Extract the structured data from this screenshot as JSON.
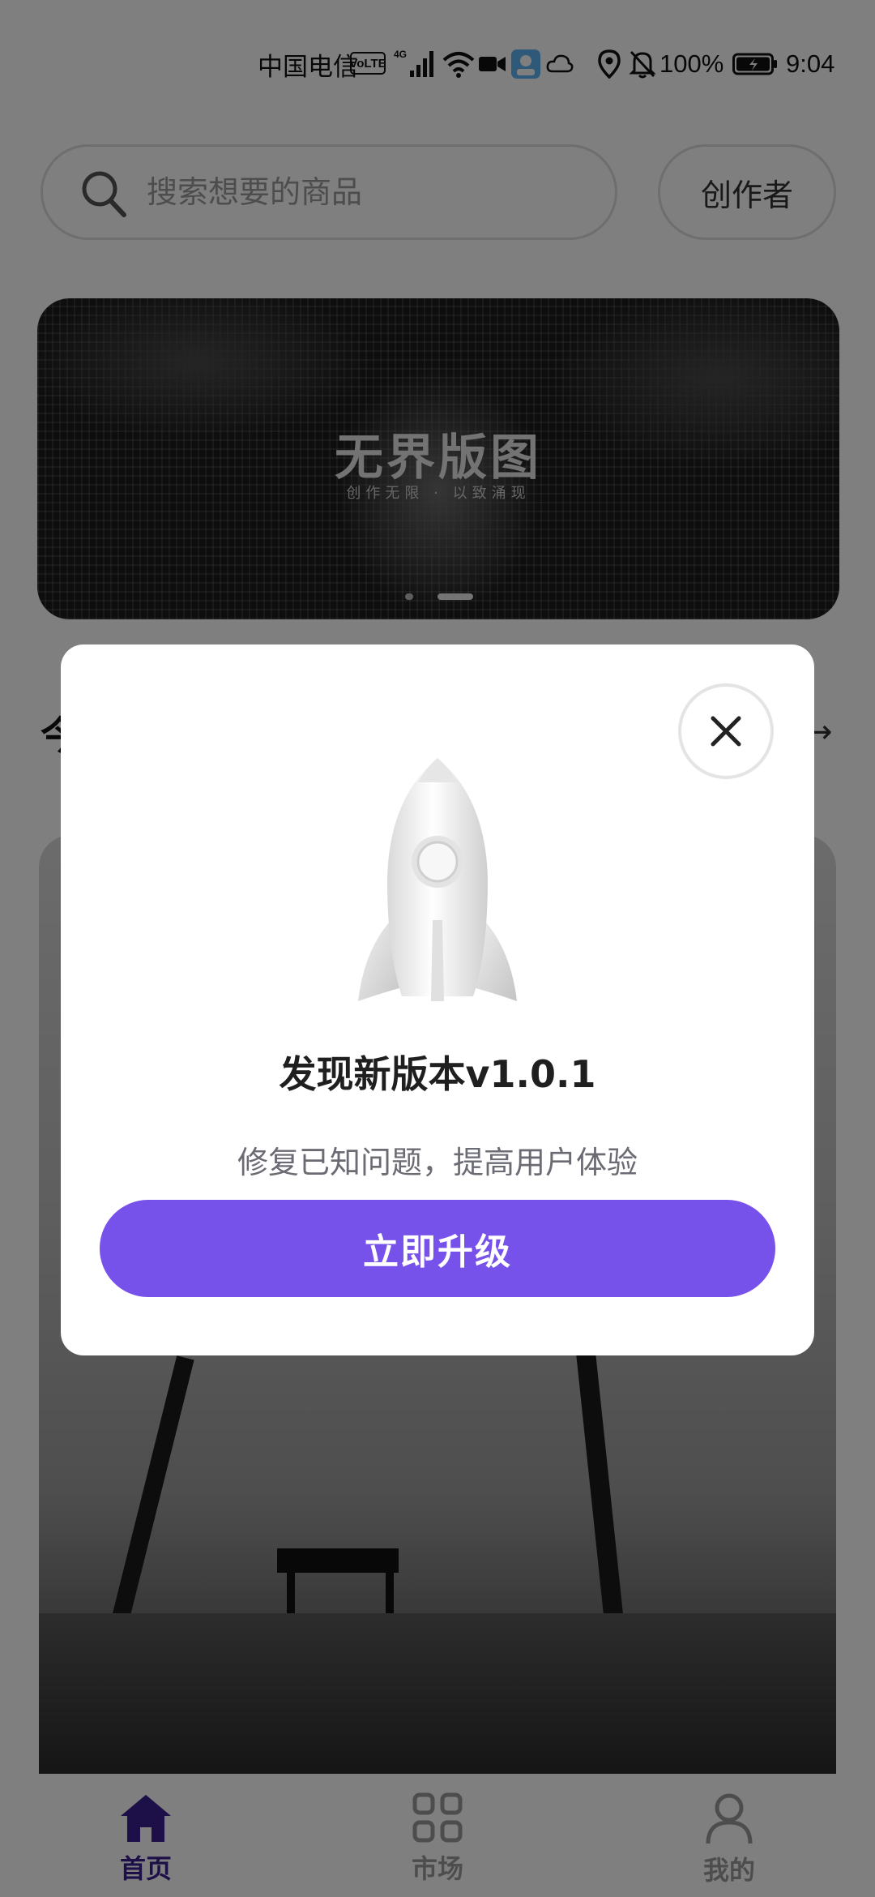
{
  "status_bar": {
    "carrier": "中国电信",
    "volte": "VoLTE",
    "network": "4G",
    "battery": "100%",
    "time": "9:04",
    "icons": [
      "volte-icon",
      "signal-icon",
      "wifi-icon",
      "video-icon",
      "app-badge-icon",
      "cloud-icon",
      "location-icon",
      "mute-bell-icon",
      "battery-icon"
    ]
  },
  "search": {
    "placeholder": "搜索想要的商品",
    "icon": "search-icon"
  },
  "header": {
    "creator_label": "创作者"
  },
  "banner": {
    "title": "无界版图",
    "subtitle": "创作无限 · 以致涌现",
    "page_count": 2,
    "active_page": 2
  },
  "section": {
    "title_partial": "今",
    "arrow": "→"
  },
  "tabs": [
    {
      "label": "首页",
      "icon": "home-icon",
      "active": true
    },
    {
      "label": "市场",
      "icon": "grid-icon",
      "active": false
    },
    {
      "label": "我的",
      "icon": "user-icon",
      "active": false
    }
  ],
  "colors": {
    "accent": "#7752ea",
    "active_tab": "#3b1f8f",
    "overlay": "rgba(0,0,0,0.5)"
  },
  "update_dialog": {
    "icon": "rocket-icon",
    "title": "发现新版本v1.0.1",
    "description": "修复已知问题，提高用户体验",
    "button_label": "立即升级",
    "close_icon": "close-icon"
  }
}
